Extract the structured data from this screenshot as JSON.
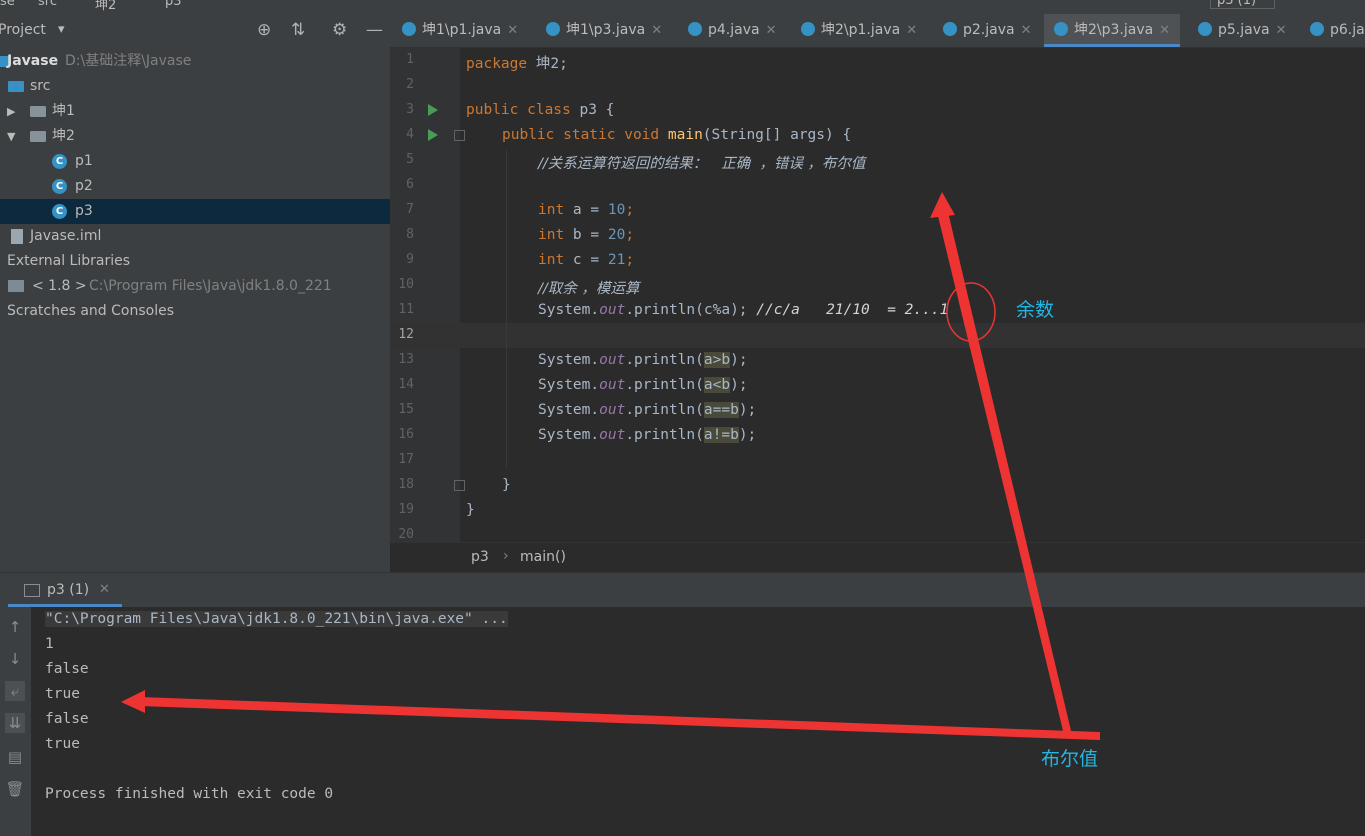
{
  "top": {
    "crumbs": [
      "se",
      "src",
      "坤2",
      "p3"
    ],
    "run_config": "p3 (1)"
  },
  "project_panel": {
    "title": "Project",
    "title_caret": "▾",
    "tree": [
      {
        "label": "Javase",
        "sub": "D:\\基础注释\\Javase"
      },
      {
        "label": "src"
      },
      {
        "label": "坤1"
      },
      {
        "label": "坤2"
      },
      {
        "label": "p1"
      },
      {
        "label": "p2"
      },
      {
        "label": "p3"
      },
      {
        "label": "Javase.iml"
      },
      {
        "label": "External Libraries"
      },
      {
        "label": "< 1.8 >",
        "sub": "C:\\Program Files\\Java\\jdk1.8.0_221"
      },
      {
        "label": "Scratches and Consoles"
      }
    ]
  },
  "tabs": [
    {
      "label": "坤1\\p1.java"
    },
    {
      "label": "坤1\\p3.java"
    },
    {
      "label": "p4.java"
    },
    {
      "label": "坤2\\p1.java"
    },
    {
      "label": "p2.java"
    },
    {
      "label": "坤2\\p3.java"
    },
    {
      "label": "p5.java"
    },
    {
      "label": "p6.ja"
    }
  ],
  "editor": {
    "line_numbers": [
      "1",
      "2",
      "3",
      "4",
      "5",
      "6",
      "7",
      "8",
      "9",
      "10",
      "11",
      "12",
      "13",
      "14",
      "15",
      "16",
      "17",
      "18",
      "19",
      "20"
    ],
    "line1_kw": "package",
    "line1_rest": " 坤2;",
    "line3_kw": "public class",
    "line3_rest": " p3 {",
    "line4_kw": "public static void",
    "line4_fn": "main",
    "line4_rest": "(String[] args) {",
    "line5_comment": "//关系运算符返回的结果：   正确  ，错误 ，布尔值",
    "line7_kw": "int",
    "line7_rest": " a = ",
    "line7_num": "10",
    "line7_end": ";",
    "line8_kw": "int",
    "line8_rest": " b = ",
    "line8_num": "20",
    "line8_end": ";",
    "line9_kw": "int",
    "line9_rest": " c = ",
    "line9_num": "21",
    "line9_end": ";",
    "line10_comment": "//取余 ，模运算",
    "line11_pre": "System.",
    "line11_fld": "out",
    "line11_mid": ".println(c%a); ",
    "line11_comment": "//c/a   21/10  = 2...1",
    "line13_pre": "System.",
    "line13_fld": "out",
    "line13_mid": ".println(",
    "line13_hl": "a>b",
    "line13_end": ");",
    "line14_pre": "System.",
    "line14_fld": "out",
    "line14_mid": ".println(",
    "line14_hl": "a<b",
    "line14_end": ");",
    "line15_pre": "System.",
    "line15_fld": "out",
    "line15_mid": ".println(",
    "line15_hl": "a==b",
    "line15_end": ");",
    "line16_pre": "System.",
    "line16_fld": "out",
    "line16_mid": ".println(",
    "line16_hl": "a!=b",
    "line16_end": ");",
    "line18": "}",
    "line19": "}"
  },
  "breadcrumb": {
    "file": "p3",
    "sep": "›",
    "method": "main()"
  },
  "run": {
    "tab_label": "p3 (1)",
    "command": "\"C:\\Program Files\\Java\\jdk1.8.0_221\\bin\\java.exe\" ...",
    "output": [
      "1",
      "false",
      "true",
      "false",
      "true"
    ],
    "finished": "Process finished with exit code 0"
  },
  "annotations": {
    "remainder": "余数",
    "boolean": "布尔值",
    "color": "#ee3333",
    "text_color": "#25b5e0"
  }
}
